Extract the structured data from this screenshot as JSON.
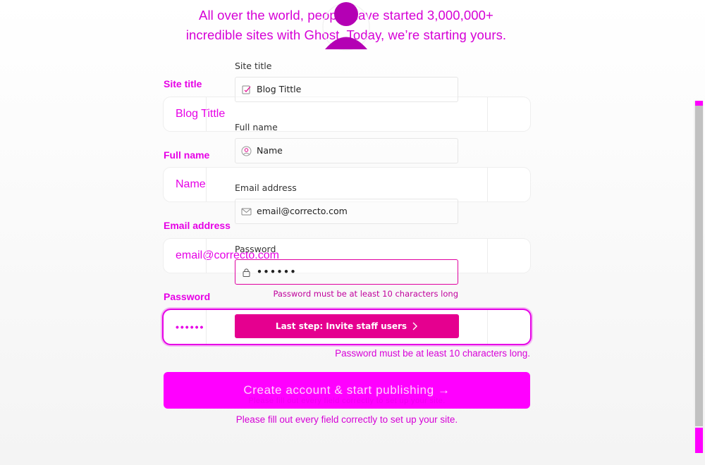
{
  "headline": {
    "line1": "All over the world, people have started 3,000,000+",
    "line2": "incredible sites with Ghost. Today, we’re starting yours."
  },
  "avatar": {
    "icon": "user-avatar-icon",
    "color": "#b400b4"
  },
  "form_back": {
    "fields": [
      {
        "label": "Site title",
        "value": "Blog Tittle"
      },
      {
        "label": "Full name",
        "value": "Name"
      },
      {
        "label": "Email address",
        "value": "email@correcto.com"
      },
      {
        "label": "Password",
        "value": "••••••"
      }
    ],
    "error": "Password must be at least 10 characters long.",
    "submit_label": "Create account & start publishing →",
    "submit_ghost": "Please fill out every field correctly to set up your site.",
    "footnote": "Please fill out every field correctly to set up your site."
  },
  "form_front": {
    "fields": [
      {
        "label": "Site title",
        "value": "Blog Tittle",
        "icon": "edit-document-icon"
      },
      {
        "label": "Full name",
        "value": "Name",
        "icon": "user-circle-icon"
      },
      {
        "label": "Email address",
        "value": "email@correcto.com",
        "icon": "envelope-icon"
      },
      {
        "label": "Password",
        "value": "••••••",
        "icon": "lock-icon"
      }
    ],
    "hint": "Password must be at least 10 characters long",
    "next_label": "Last step: Invite staff users"
  },
  "colors": {
    "magenta": "#ff00ff",
    "brand_pink": "#e5008f",
    "text_magenta": "#e600e6"
  }
}
